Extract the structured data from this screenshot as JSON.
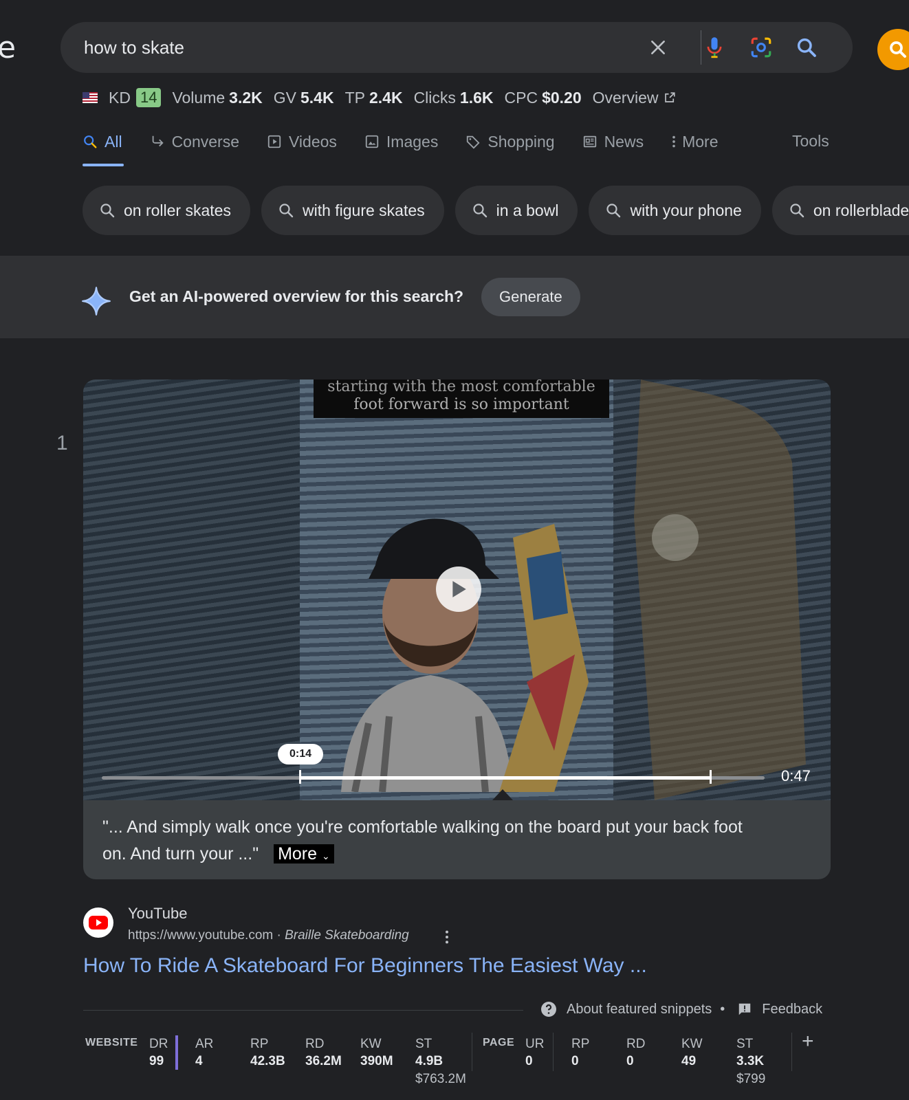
{
  "header": {
    "logo_fragment": "e",
    "search_query": "how to skate"
  },
  "seo_bar": {
    "kd_label": "KD",
    "kd_value": "14",
    "volume_label": "Volume",
    "volume_value": "3.2K",
    "gv_label": "GV",
    "gv_value": "5.4K",
    "tp_label": "TP",
    "tp_value": "2.4K",
    "clicks_label": "Clicks",
    "clicks_value": "1.6K",
    "cpc_label": "CPC",
    "cpc_value": "$0.20",
    "overview_label": "Overview"
  },
  "tabs": [
    {
      "label": "All",
      "icon": "search-icon"
    },
    {
      "label": "Converse",
      "icon": "converse-icon"
    },
    {
      "label": "Videos",
      "icon": "video-icon"
    },
    {
      "label": "Images",
      "icon": "image-icon"
    },
    {
      "label": "Shopping",
      "icon": "tag-icon"
    },
    {
      "label": "News",
      "icon": "news-icon"
    },
    {
      "label": "More",
      "icon": "more-vert-icon"
    }
  ],
  "tools_label": "Tools",
  "chips": [
    "on roller skates",
    "with figure skates",
    "in a bowl",
    "with your phone",
    "on rollerblades"
  ],
  "ai_overview": {
    "prompt": "Get an AI-powered overview for this search?",
    "button": "Generate"
  },
  "result": {
    "rank": "1",
    "video": {
      "caption_line1": "starting with the most comfortable",
      "caption_line2": "foot forward is so important",
      "current_time": "0:14",
      "duration": "0:47",
      "progress_fraction": 0.2979
    },
    "transcript_line1": "\"... And simply walk once you're comfortable walking on the board put your back foot",
    "transcript_line2": "on. And turn your ...\"",
    "more_label": "More",
    "site_name": "YouTube",
    "url": "https://www.youtube.com",
    "url_sep": " · ",
    "channel": "Braille Skateboarding",
    "title": "How To Ride A Skateboard For Beginners The Easiest Way ..."
  },
  "snippet_footer": {
    "about": "About featured snippets",
    "dot": "•",
    "feedback": "Feedback"
  },
  "metrics": {
    "website_label": "WEBSITE",
    "page_label": "PAGE",
    "website": [
      {
        "label": "DR",
        "value": "99"
      },
      {
        "label": "AR",
        "value": "4"
      },
      {
        "label": "RP",
        "value": "42.3B"
      },
      {
        "label": "RD",
        "value": "36.2M"
      },
      {
        "label": "KW",
        "value": "390M"
      },
      {
        "label": "ST",
        "value": "4.9B",
        "sub": "$763.2M"
      }
    ],
    "page": [
      {
        "label": "UR",
        "value": "0"
      },
      {
        "label": "RP",
        "value": "0"
      },
      {
        "label": "RD",
        "value": "0"
      },
      {
        "label": "KW",
        "value": "49"
      },
      {
        "label": "ST",
        "value": "3.3K",
        "sub": "$799"
      }
    ],
    "add_label": "+"
  },
  "colors": {
    "background": "#202124",
    "link": "#8ab4f8",
    "kd_badge": "#88c987",
    "avatar": "#f29900",
    "dr_accent": "#7e6fd9"
  }
}
